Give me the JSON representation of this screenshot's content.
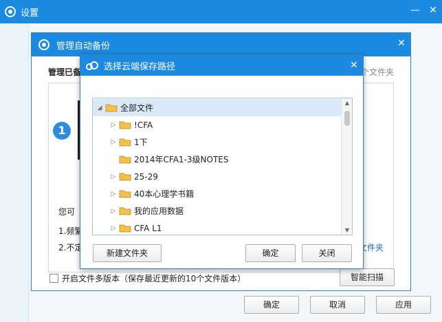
{
  "settings": {
    "title": "设置",
    "ok": "确定",
    "cancel": "取消",
    "apply": "应用"
  },
  "backup": {
    "title": "管理自动备份",
    "managed_prefix": "管理已备",
    "right_fragment": "个文件夹",
    "step_number": "1",
    "you_can": "您可",
    "line1": "1.频繁",
    "line2": "2.不定",
    "folder_link": "文件夹",
    "multi_version_label": "开启文件多版本（保存最近更新的10个文件版本）",
    "smart_scan": "智能扫描"
  },
  "chooser": {
    "title": "选择云端保存路径",
    "tree": [
      {
        "label": "全部文件",
        "expanded": true,
        "level": 0,
        "selected": true
      },
      {
        "label": "!CFA",
        "level": 1,
        "has_children": true
      },
      {
        "label": "1下",
        "level": 1,
        "has_children": true
      },
      {
        "label": "2014年CFA1-3级NOTES",
        "level": 1,
        "has_children": false
      },
      {
        "label": "25-29",
        "level": 1,
        "has_children": true
      },
      {
        "label": "40本心理学书籍",
        "level": 1,
        "has_children": true
      },
      {
        "label": "我的应用数据",
        "level": 1,
        "has_children": true
      },
      {
        "label": "CFA L1",
        "level": 1,
        "has_children": true
      }
    ],
    "new_folder": "新建文件夹",
    "ok": "确定",
    "close": "关闭"
  },
  "colors": {
    "titlebar": "#1b8ae0",
    "accent_link": "#1a6fd1",
    "folder": "#f3c04c",
    "selection": "#d9e9f8"
  }
}
